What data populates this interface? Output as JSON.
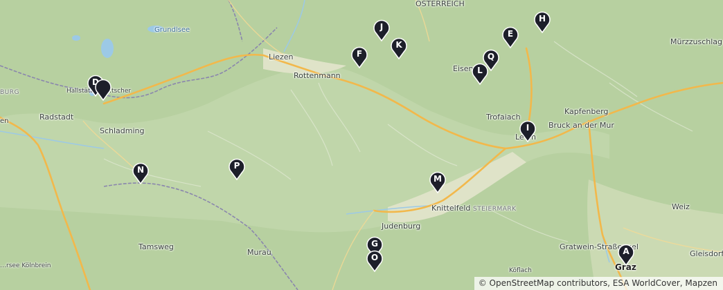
{
  "map": {
    "places": {
      "osterreich": "ÖSTERREICH",
      "grundlsee": "Grundlsee",
      "liezen": "Liezen",
      "rottenmann": "Rottenmann",
      "eisenerz": "Eisen",
      "hallstatt": "Hallstätt",
      "bad_goisern": "…tscher",
      "burg": "BURG",
      "radstadt": "Radstadt",
      "schladming": "Schladming",
      "trofaiach": "Trofaiach",
      "kapfenberg": "Kapfenberg",
      "bruck": "Bruck an der Mur",
      "leoben": "Le      en",
      "murzzuschlag": "Mürzzuschlag",
      "knittelfeld": "Knittelfeld",
      "steiermark": "STEIERMARK",
      "judenburg": "Judenburg",
      "weiz": "Weiz",
      "tamsweg": "Tamsweg",
      "murau": "Murau",
      "gratwein": "Gratwein-Straßengel",
      "graz": "Graz",
      "gleisdorf": "Gleisdorf",
      "koflach": "Köflach",
      "krems": "…rsee Kölnbrein",
      "en": "en"
    },
    "markers": [
      {
        "label": "A"
      },
      {
        "label": "D"
      },
      {
        "label": "E"
      },
      {
        "label": "F"
      },
      {
        "label": "G"
      },
      {
        "label": "H"
      },
      {
        "label": "I"
      },
      {
        "label": "J"
      },
      {
        "label": "K"
      },
      {
        "label": "L"
      },
      {
        "label": "M"
      },
      {
        "label": "N"
      },
      {
        "label": "O"
      },
      {
        "label": "P"
      },
      {
        "label": "Q"
      }
    ],
    "attribution": "© OpenStreetMap contributors, ESA WorldCover, Mapzen",
    "colors": {
      "terrain": "#b9d1a2",
      "valley": "#dfe3c9",
      "highway": "#f2b84b",
      "water": "#9cc9e6",
      "border": "#8a86ad",
      "marker": "#1d1f2a"
    }
  }
}
